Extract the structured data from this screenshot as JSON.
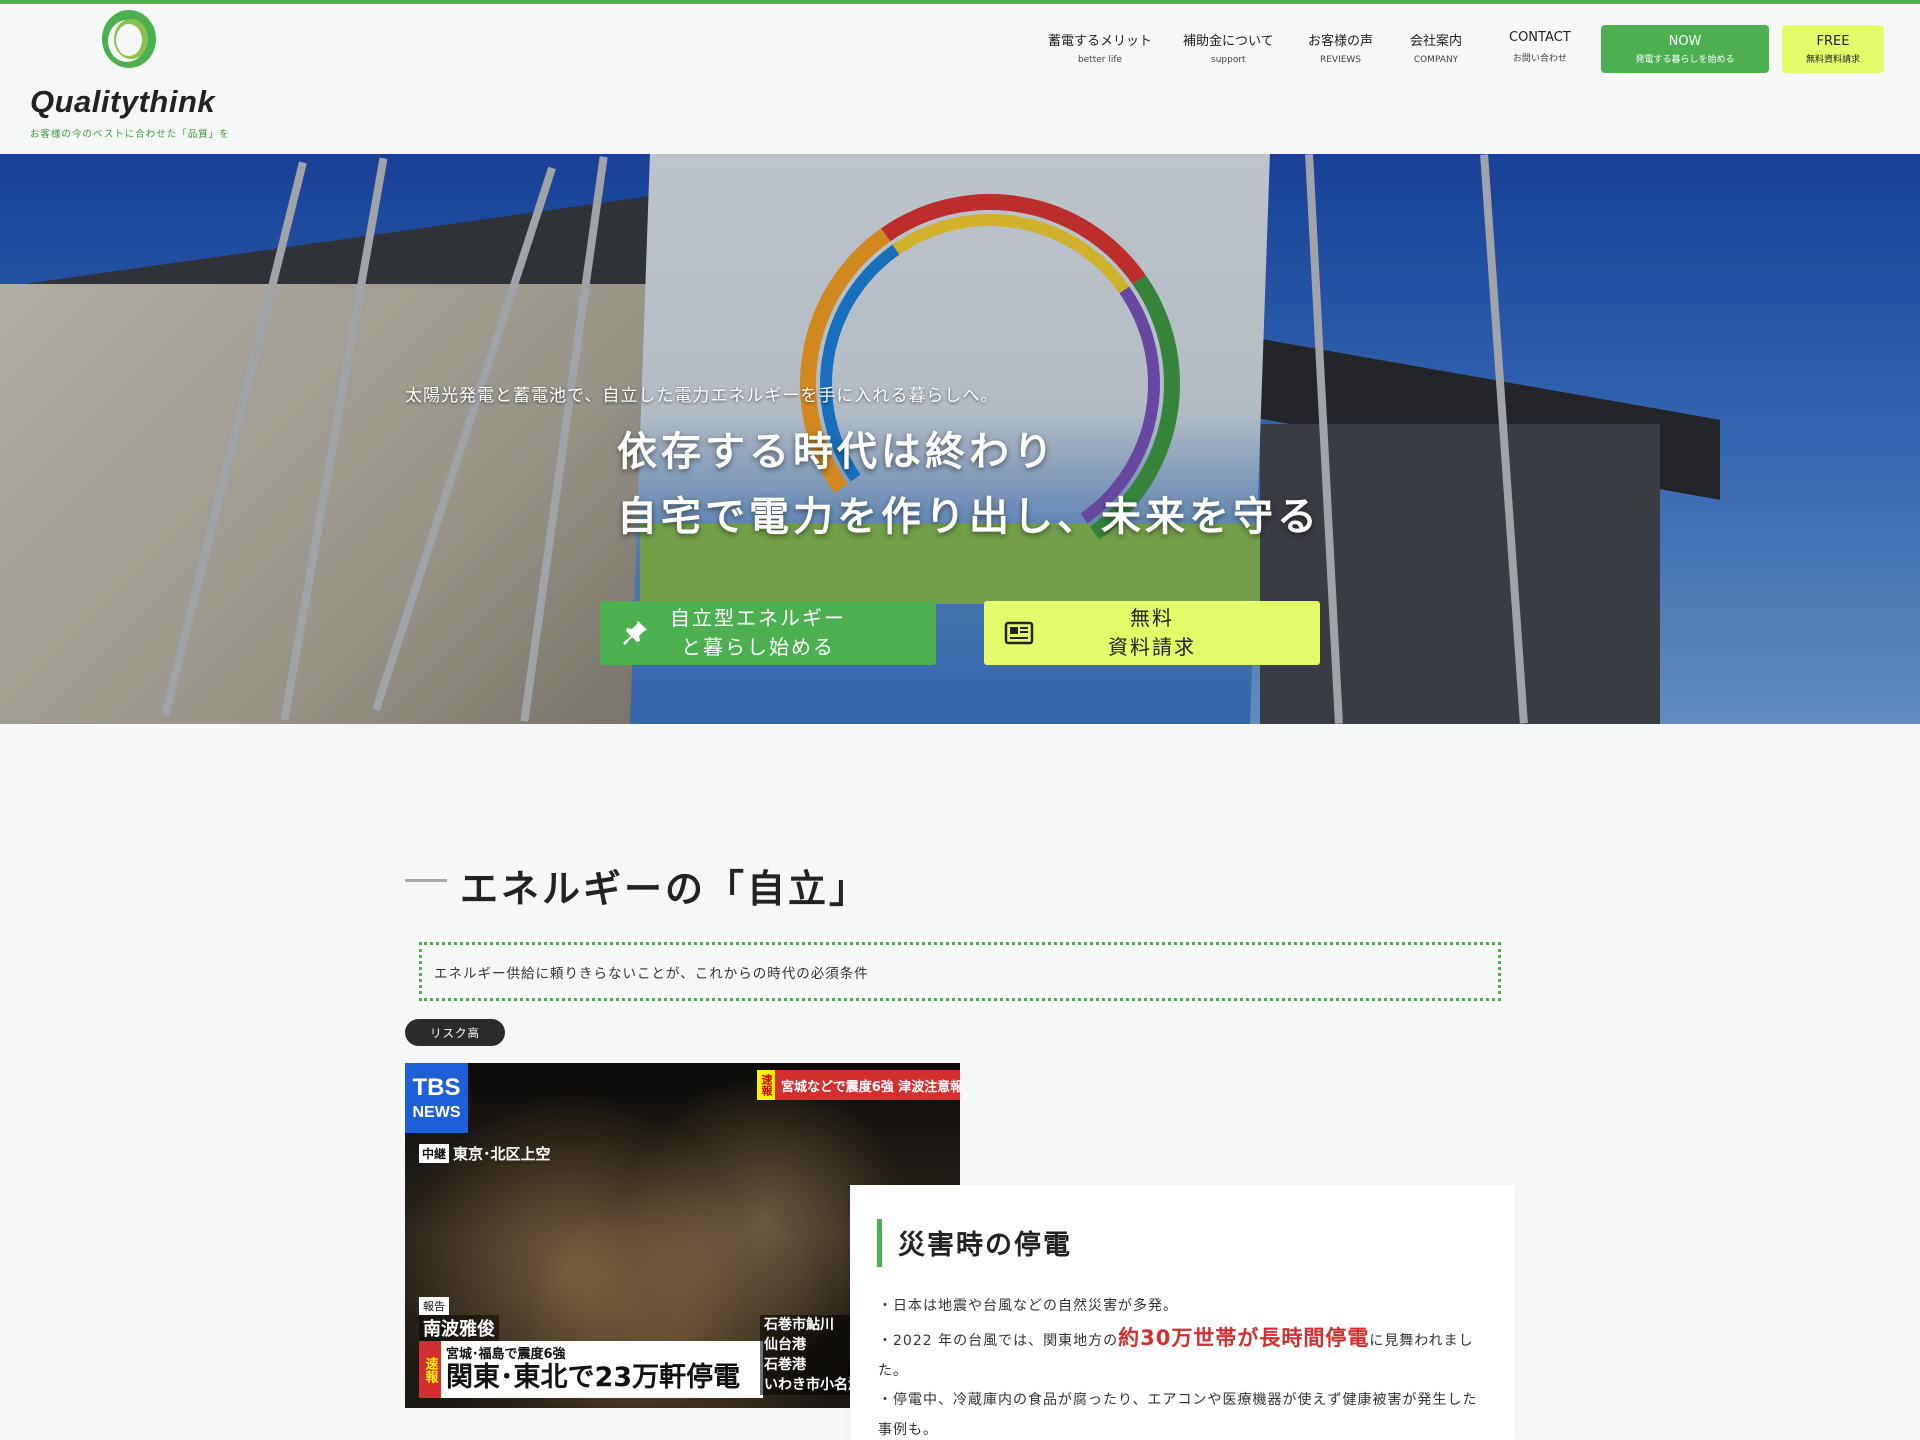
{
  "brand": {
    "name": "Qualitythink",
    "tagline": "お客様の今のベストに合わせた「品質」を",
    "accent": "#4caf50",
    "highlight": "#e6fb6a"
  },
  "nav": [
    {
      "ja": "蓄電するメリット",
      "en": "better life"
    },
    {
      "ja": "補助金について",
      "en": "support"
    },
    {
      "ja": "お客様の声",
      "en": "REVIEWS"
    },
    {
      "ja": "会社案内",
      "en": "COMPANY"
    },
    {
      "ja": "CONTACT",
      "en": "お問い合わせ"
    }
  ],
  "header_buttons": {
    "now": {
      "label": "NOW",
      "sub": "発電する暮らしを始める"
    },
    "free": {
      "label": "FREE",
      "sub": "無料資料請求"
    }
  },
  "hero": {
    "sub": "太陽光発電と蓄電池で、自立した電力エネルギーを手に入れる暮らしへ。",
    "line1": "依存する時代は終わり",
    "line2": "自宅で電力を作り出し、未来を守る",
    "cta_start_line1": "自立型エネルギー",
    "cta_start_line2": "と暮らし始める",
    "cta_free_line1": "無料",
    "cta_free_line2": "資料請求",
    "pin_icon": "pushpin-icon",
    "doc_icon": "newspaper-icon"
  },
  "section": {
    "title": "エネルギーの「自立」",
    "lead": "エネルギー供給に頼りきらないことが、これからの時代の必須条件",
    "badge": "リスク高"
  },
  "news_image": {
    "logo_top": "TBS",
    "logo_bottom": "NEWS",
    "flash_tag": "速報",
    "flash_text": "宮城などで震度6強 津波注意報",
    "live_tag": "中継",
    "live_text": "東京･北区上空",
    "report_tag": "報告",
    "reporter": "南波雅俊",
    "lower_tag": "速報",
    "lower_line1": "宮城･福島で震度6強",
    "lower_line2": "関東･東北で23万軒停電",
    "ports": [
      "石巻市鮎川",
      "仙台港",
      "石巻港",
      "いわき市小名浜"
    ]
  },
  "card": {
    "title": "災害時の停電",
    "p1": "・日本は地震や台風などの自然災害が多発。",
    "p2_before": "・2022 年の台風では、関東地方の",
    "p2_highlight": "約30万世帯が長時間停電",
    "p2_after": "に見舞われました。",
    "p3": "・停電中、冷蔵庫内の食品が腐ったり、エアコンや医療機器が使えず健康被害が発生した事例も。"
  }
}
